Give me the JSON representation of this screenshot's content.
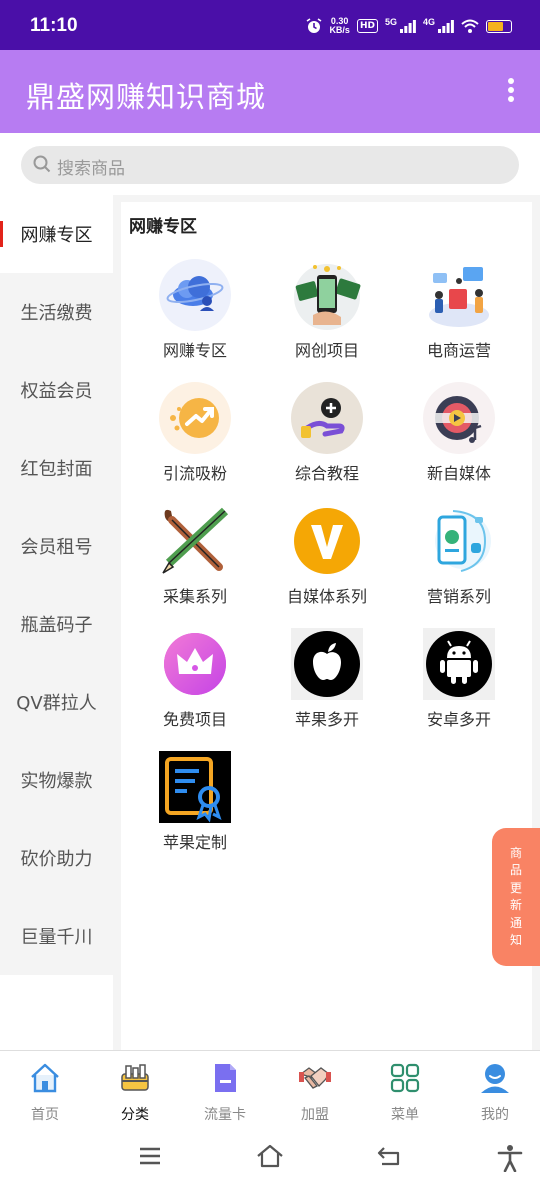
{
  "status_bar": {
    "time": "11:10",
    "net_speed_value": "0.30",
    "net_speed_unit": "KB/s",
    "hd_badge": "HD",
    "net_5g": "5G",
    "net_4g": "4G"
  },
  "header": {
    "title": "鼎盛网赚知识商城",
    "background": "#b77cf2"
  },
  "search": {
    "placeholder": "搜索商品"
  },
  "sidebar": {
    "active_index": 0,
    "items": [
      {
        "label": "网赚专区"
      },
      {
        "label": "生活缴费"
      },
      {
        "label": "权益会员"
      },
      {
        "label": "红包封面"
      },
      {
        "label": "会员租号"
      },
      {
        "label": "瓶盖码子"
      },
      {
        "label": "QV群拉人"
      },
      {
        "label": "实物爆款"
      },
      {
        "label": "砍价助力"
      },
      {
        "label": "巨量千川"
      }
    ]
  },
  "panel": {
    "title": "网赚专区",
    "items": [
      {
        "label": "网赚专区",
        "icon": "cloud-user-icon"
      },
      {
        "label": "网创项目",
        "icon": "phone-money-icon"
      },
      {
        "label": "电商运营",
        "icon": "ecommerce-team-icon"
      },
      {
        "label": "引流吸粉",
        "icon": "traffic-growth-icon"
      },
      {
        "label": "综合教程",
        "icon": "hand-coin-icon"
      },
      {
        "label": "新自媒体",
        "icon": "video-media-icon"
      },
      {
        "label": "采集系列",
        "icon": "brush-pencil-icon"
      },
      {
        "label": "自媒体系列",
        "icon": "v-badge-icon"
      },
      {
        "label": "营销系列",
        "icon": "phone-marketing-icon"
      },
      {
        "label": "免费项目",
        "icon": "crown-icon"
      },
      {
        "label": "苹果多开",
        "icon": "apple-icon"
      },
      {
        "label": "安卓多开",
        "icon": "android-icon"
      },
      {
        "label": "苹果定制",
        "icon": "certificate-icon"
      }
    ]
  },
  "notify": {
    "chars": [
      "商",
      "品",
      "更",
      "新",
      "通",
      "知"
    ],
    "color": "#f98364"
  },
  "tabbar": {
    "active_index": 1,
    "items": [
      {
        "label": "首页",
        "icon": "home-icon"
      },
      {
        "label": "分类",
        "icon": "category-icon"
      },
      {
        "label": "流量卡",
        "icon": "sim-card-icon"
      },
      {
        "label": "加盟",
        "icon": "handshake-icon"
      },
      {
        "label": "菜单",
        "icon": "grid-menu-icon"
      },
      {
        "label": "我的",
        "icon": "user-icon"
      }
    ]
  }
}
